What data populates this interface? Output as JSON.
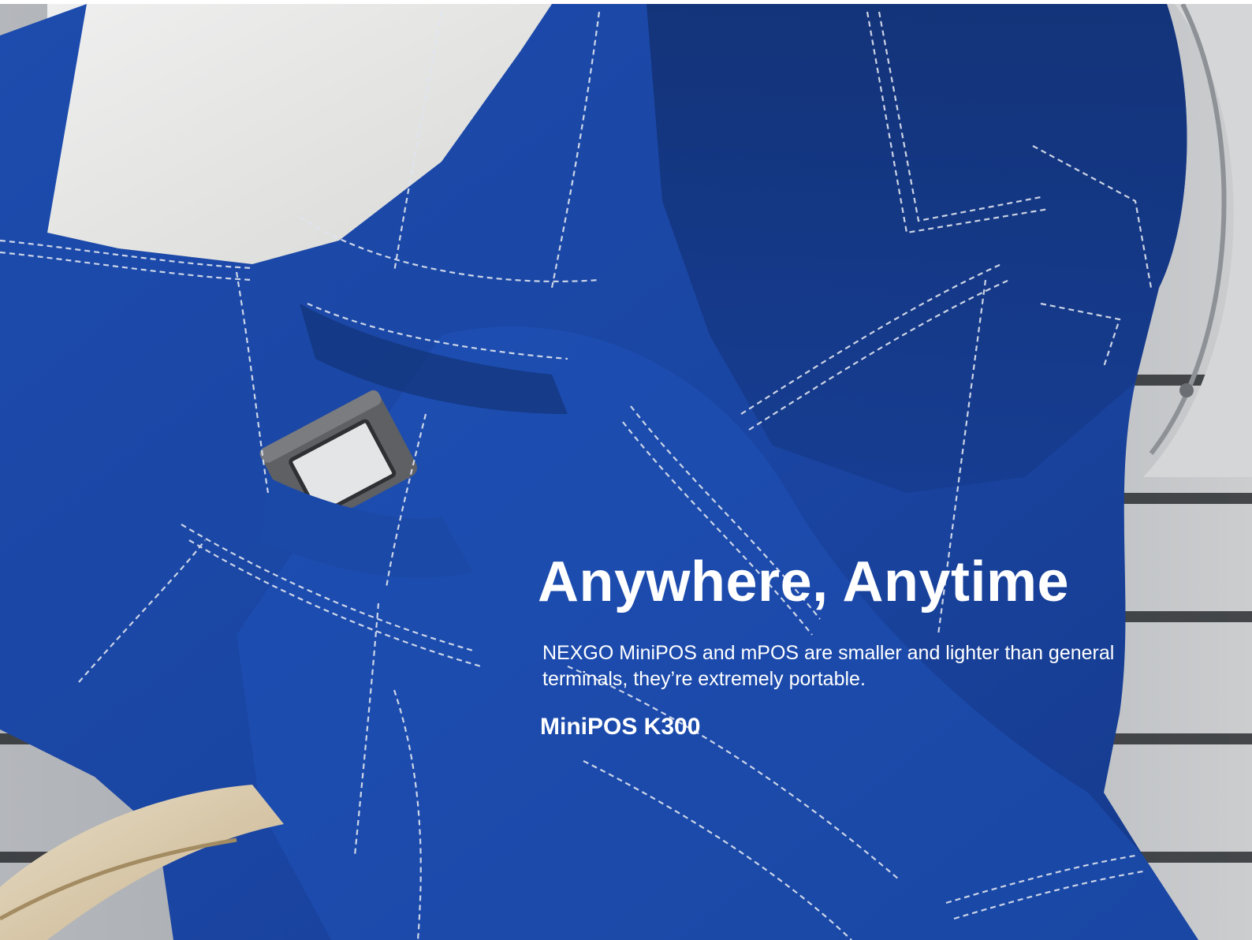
{
  "hero": {
    "headline": "Anywhere, Anytime",
    "description": "NEXGO MiniPOS and mPOS are smaller and lighter than general terminals, they’re extremely portable.",
    "product_name": "MiniPOS K300"
  },
  "colors": {
    "fabric_blue": "#1a46a6",
    "text": "#ffffff"
  }
}
